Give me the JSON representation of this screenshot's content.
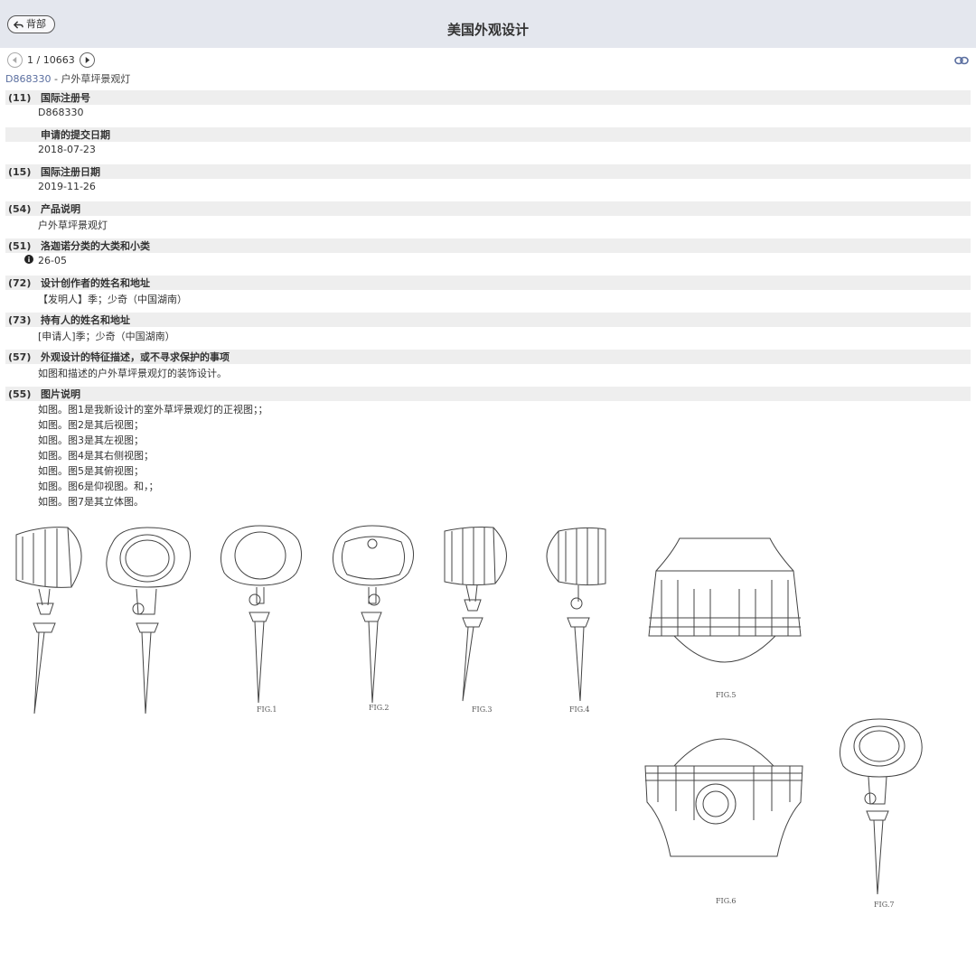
{
  "header": {
    "back_label": "背部",
    "title": "美国外观设计"
  },
  "pager": {
    "current": "1 / 10663"
  },
  "subtitle": {
    "number": "D868330",
    "separator": " - ",
    "name": "户外草坪景观灯"
  },
  "records": [
    {
      "code": "(11)",
      "label": "国际注册号",
      "value": "D868330"
    },
    {
      "code": "",
      "label": "申请的提交日期",
      "value": "2018-07-23"
    },
    {
      "code": "(15)",
      "label": "国际注册日期",
      "value": "2019-11-26"
    },
    {
      "code": "(54)",
      "label": "产品说明",
      "value": "户外草坪景观灯"
    },
    {
      "code": "(51)",
      "label": "洛迦诺分类的大类和小类",
      "value": "26-05"
    },
    {
      "code": "(72)",
      "label": "设计创作者的姓名和地址",
      "value": "【发明人】季；少奇（中国湖南）"
    },
    {
      "code": "(73)",
      "label": "持有人的姓名和地址",
      "value": "[申请人]季；少奇（中国湖南）"
    },
    {
      "code": "(57)",
      "label": "外观设计的特征描述，或不寻求保护的事项",
      "value": "如图和描述的户外草坪景观灯的装饰设计。"
    }
  ],
  "figure_desc": {
    "code": "(55)",
    "label": "图片说明",
    "lines": [
      "如图。图1是我新设计的室外草坪景观灯的正视图；；",
      "如图。图2是其后视图；",
      "如图。图3是其左视图；",
      "如图。图4是其右侧视图；",
      "如图。图5是其俯视图；",
      "如图。图6是仰视图。和，；",
      "如图。图7是其立体图。"
    ]
  },
  "figures": {
    "labels": [
      "FIG.1",
      "FIG.2",
      "FIG.3",
      "FIG.4",
      "FIG.5",
      "FIG.6",
      "FIG.7"
    ]
  },
  "icons": {
    "back": "back-arrow-icon",
    "prev": "chevron-left-icon",
    "next": "chevron-right-icon",
    "link": "link-icon",
    "info": "info-icon"
  },
  "colors": {
    "header_bg": "#e4e7ee",
    "row_bg": "#eeeeee",
    "link_blue": "#5b6fa0"
  }
}
